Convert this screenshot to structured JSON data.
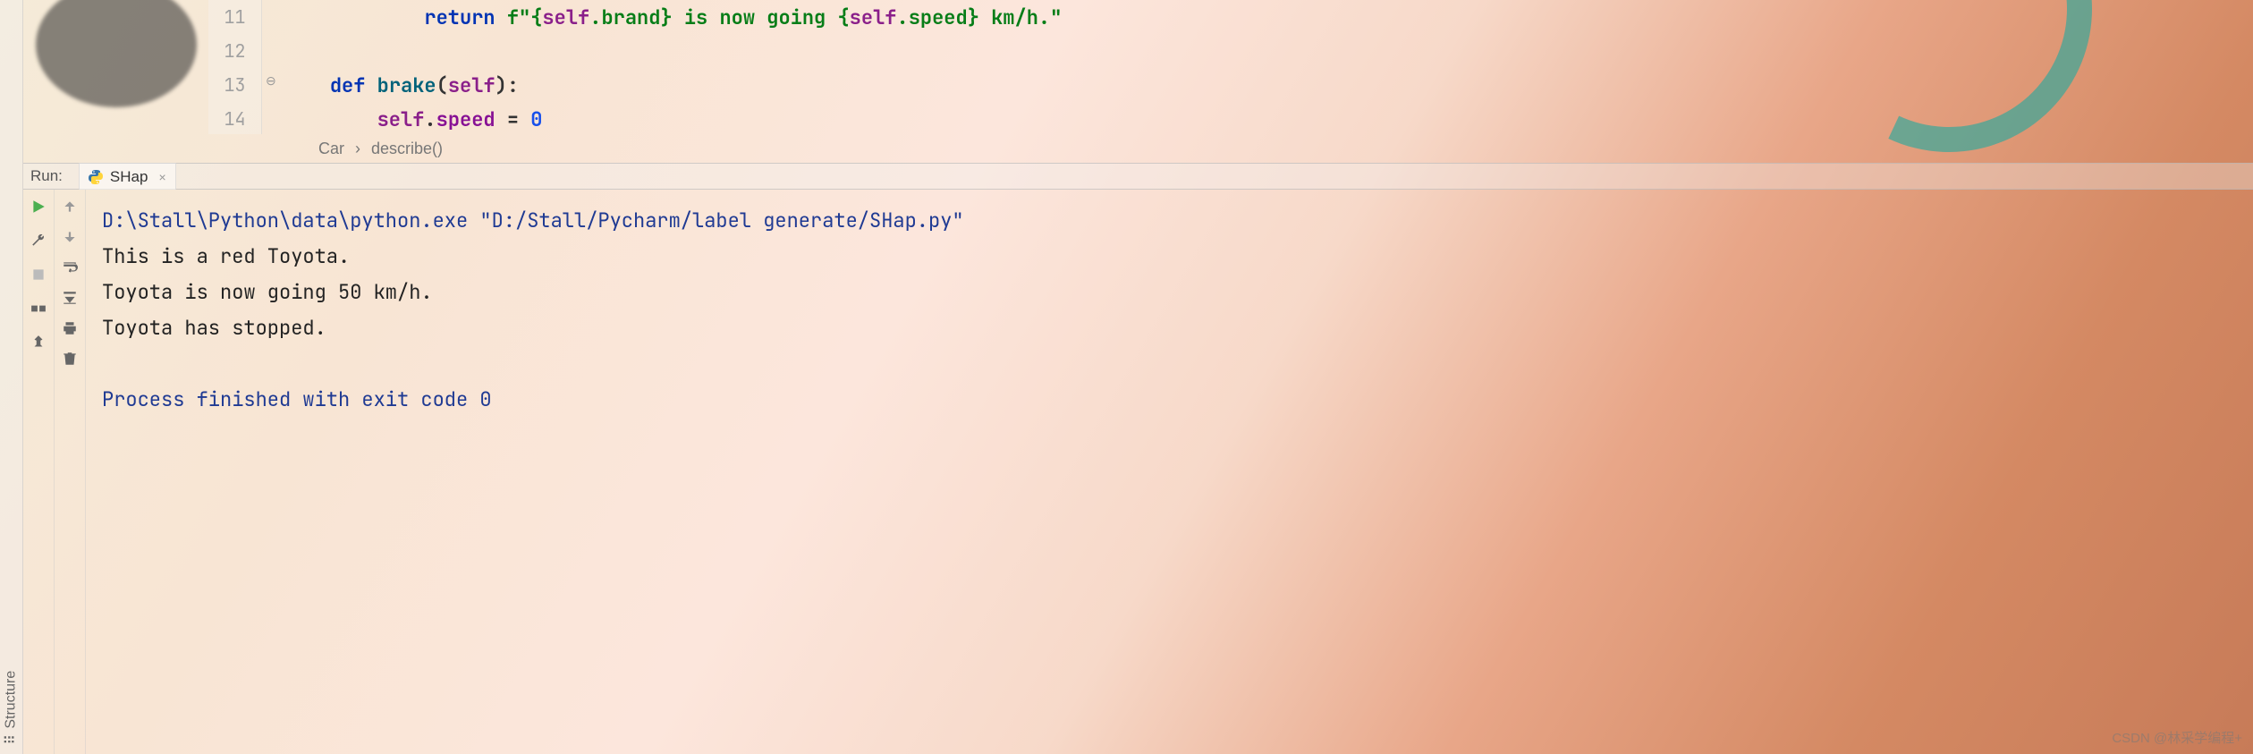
{
  "editor": {
    "lines": [
      {
        "num": "11"
      },
      {
        "num": "12"
      },
      {
        "num": "13"
      },
      {
        "num": "14"
      }
    ],
    "code": {
      "l11": {
        "pre": "            ",
        "kw": "return",
        "sp": " ",
        "strp1": "f\"{",
        "self1": "self",
        "d1": ".",
        "attr1": "brand",
        "mid": "} ",
        "strp2": "is now going",
        "sp2": " {",
        "self2": "self",
        "d2": ".",
        "attr2": "speed",
        "end": "} km/h.\""
      },
      "l13": {
        "pre": "    ",
        "kw": "def",
        "sp": " ",
        "fn": "brake",
        "lp": "(",
        "param": "self",
        "rp": "):"
      },
      "l14": {
        "pre": "        ",
        "self": "self",
        "d": ".",
        "attr": "speed ",
        "eq": "= ",
        "num": "0"
      }
    }
  },
  "breadcrumbs": {
    "item1": "Car",
    "sep": "›",
    "item2": "describe()"
  },
  "run": {
    "label": "Run:",
    "tab_name": "SHap"
  },
  "console": {
    "command": "D:\\Stall\\Python\\data\\python.exe \"D:/Stall/Pycharm/label generate/SHap.py\"",
    "out1": "This is a red Toyota.",
    "out2": "Toyota is now going 50 km/h.",
    "out3": "Toyota has stopped.",
    "blank": "",
    "exit": "Process finished with exit code 0"
  },
  "sidebar": {
    "structure": "Structure"
  },
  "watermark": "CSDN @林采学编程+"
}
